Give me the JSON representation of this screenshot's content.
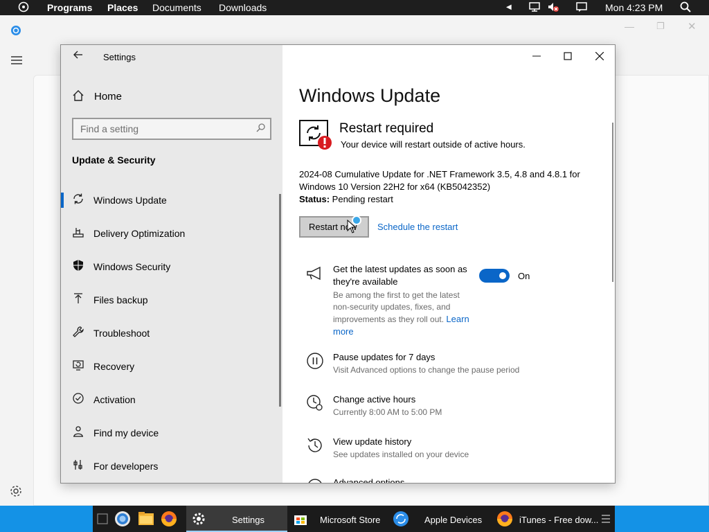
{
  "topbar": {
    "programs": "Programs",
    "places": "Places",
    "documents": "Documents",
    "downloads": "Downloads",
    "clock": "Mon 4:23 PM"
  },
  "settings": {
    "window_title": "Settings",
    "home": "Home",
    "search_placeholder": "Find a setting",
    "section": "Update & Security",
    "nav": [
      {
        "label": "Windows Update",
        "icon": "refresh-icon",
        "selected": true
      },
      {
        "label": "Delivery Optimization",
        "icon": "delivery-icon",
        "selected": false
      },
      {
        "label": "Windows Security",
        "icon": "shield-icon",
        "selected": false
      },
      {
        "label": "Files backup",
        "icon": "backup-icon",
        "selected": false
      },
      {
        "label": "Troubleshoot",
        "icon": "wrench-icon",
        "selected": false
      },
      {
        "label": "Recovery",
        "icon": "recovery-icon",
        "selected": false
      },
      {
        "label": "Activation",
        "icon": "check-circle-icon",
        "selected": false
      },
      {
        "label": "Find my device",
        "icon": "person-location-icon",
        "selected": false
      },
      {
        "label": "For developers",
        "icon": "developer-icon",
        "selected": false
      }
    ],
    "main": {
      "title": "Windows Update",
      "restart_title": "Restart required",
      "restart_sub": "Your device will restart outside of active hours.",
      "update_name": "2024-08 Cumulative Update for .NET Framework 3.5, 4.8 and 4.8.1 for Windows 10 Version 22H2 for x64 (KB5042352)",
      "status_label": "Status:",
      "status_value": " Pending restart",
      "restart_now": "Restart now",
      "schedule": "Schedule the restart",
      "latest_title": "Get the latest updates as soon as they're available",
      "latest_desc": "Be among the first to get the latest non-security updates, fixes, and improvements as they roll out.",
      "learn_more": "Learn more",
      "toggle_label": "On",
      "toggle_on": true,
      "options": [
        {
          "title": "Pause updates for 7 days",
          "sub": "Visit Advanced options to change the pause period"
        },
        {
          "title": "Change active hours",
          "sub": "Currently 8:00 AM to 5:00 PM"
        },
        {
          "title": "View update history",
          "sub": "See updates installed on your device"
        },
        {
          "title": "Advanced options",
          "sub": ""
        }
      ]
    }
  },
  "taskbar": {
    "items": [
      {
        "label": "Settings"
      },
      {
        "label": "Microsoft Store"
      },
      {
        "label": "Apple Devices"
      },
      {
        "label": "iTunes - Free dow..."
      }
    ]
  },
  "colors": {
    "accent": "#0a66c8",
    "taskbar": "#1492e6",
    "topbar": "#1e1e1e"
  }
}
